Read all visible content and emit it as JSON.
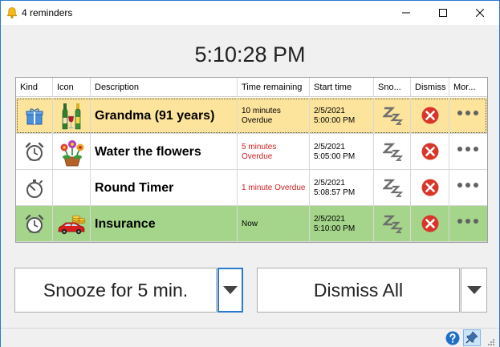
{
  "window": {
    "title": "4 reminders"
  },
  "clock": {
    "time": "5:10:28 PM"
  },
  "grid": {
    "columns": [
      "Kind",
      "Icon",
      "Description",
      "Time remaining",
      "Start time",
      "Sno...",
      "Dismiss",
      "Mor..."
    ],
    "rows": [
      {
        "description": "Grandma (91 years)",
        "remaining_1": "10 minutes",
        "remaining_2": "Overdue",
        "date": "2/5/2021",
        "time": "5:00:00 PM",
        "kind_icon": "gift-icon",
        "item_icon": "wine-bottles-icon",
        "row_color": "#fde49c",
        "remaining_color": "#000000"
      },
      {
        "description": "Water the flowers",
        "remaining_1": "5 minutes",
        "remaining_2": "Overdue",
        "date": "2/5/2021",
        "time": "5:05:00 PM",
        "kind_icon": "alarm-clock-icon",
        "item_icon": "flower-pot-icon",
        "row_color": "#ffffff",
        "remaining_color": "#d02020"
      },
      {
        "description": "Round Timer",
        "remaining_1": "1 minute Overdue",
        "remaining_2": "",
        "date": "2/5/2021",
        "time": "5:08:57 PM",
        "kind_icon": "stopwatch-icon",
        "item_icon": "",
        "row_color": "#ffffff",
        "remaining_color": "#d02020"
      },
      {
        "description": "Insurance",
        "remaining_1": "Now",
        "remaining_2": "",
        "date": "2/5/2021",
        "time": "5:10:00 PM",
        "kind_icon": "alarm-clock-icon",
        "item_icon": "car-coins-icon",
        "row_color": "#a5d58a",
        "remaining_color": "#000000"
      }
    ]
  },
  "buttons": {
    "snooze_label": "Snooze for 5 min.",
    "dismiss_all_label": "Dismiss All"
  },
  "colors": {
    "accent": "#2b79d0",
    "dismiss_red": "#d9362b",
    "help_blue": "#1e6fc8"
  }
}
